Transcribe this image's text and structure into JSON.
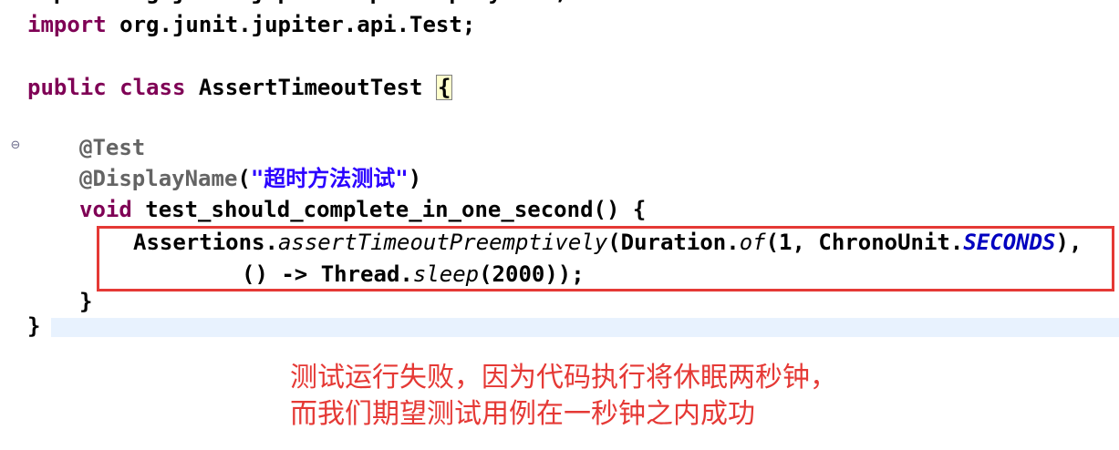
{
  "editor": {
    "clipped_top_line": "import org.junit.jupiter.api.DisplayName;",
    "import_kw": "import",
    "import_rest": " org.junit.jupiter.api.Test;",
    "class_kw_public": "public",
    "class_kw_class": "class",
    "class_name": " AssertTimeoutTest ",
    "class_open_brace": "{",
    "annotation_test": "@Test",
    "annotation_display": "@DisplayName",
    "display_paren_open": "(",
    "display_string": "\"超时方法测试\"",
    "display_paren_close": ")",
    "method_kw_void": "void",
    "method_signature": " test_should_complete_in_one_second() {",
    "stmt1_obj": "Assertions.",
    "stmt1_method": "assertTimeoutPreemptively",
    "stmt1_arg1_a": "(Duration.",
    "stmt1_arg1_of": "of",
    "stmt1_arg1_b": "(1, ChronoUnit.",
    "stmt1_arg1_const": "SECONDS",
    "stmt1_arg1_c": "),",
    "stmt2_a": "() -> Thread.",
    "stmt2_sleep": "sleep",
    "stmt2_b": "(2000));",
    "method_close_brace": "}",
    "class_close_brace": "}"
  },
  "gutter": {
    "fold_icon": "⊖"
  },
  "annotation": {
    "line1": "测试运行失败，因为代码执行将休眠两秒钟，",
    "line2": "而我们期望测试用例在一秒钟之内成功"
  },
  "colors": {
    "keyword": "#7f0055",
    "annotation": "#646464",
    "string": "#2a00ff",
    "constant": "#0000c0",
    "highlight_border": "#e53935",
    "callout_text": "#e53935",
    "current_line_bg": "#e8f2fe"
  }
}
